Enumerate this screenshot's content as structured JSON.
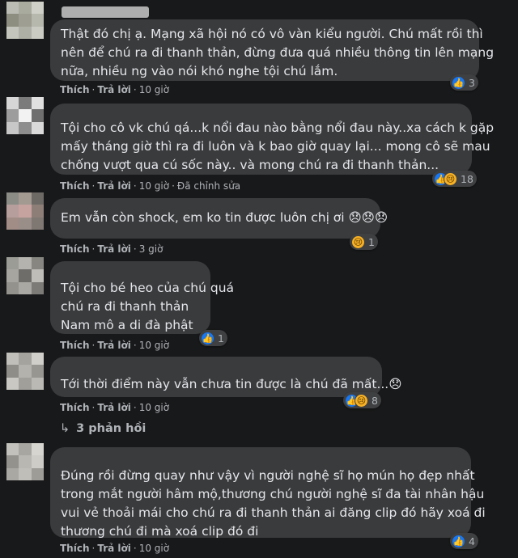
{
  "actions": {
    "like": "Thích",
    "reply": "Trả lời",
    "edited": "Đã chỉnh sửa"
  },
  "colors": {
    "like": "#1877f2",
    "sad": "#f7b125",
    "bubble": "#3a3b3c",
    "background": "#18191a"
  },
  "comments": [
    {
      "lines": [
        "Thật đó chị ạ. Mạng xã hội nó có vô vàn kiểu người. Chú mất rồi thì",
        "nên để chú ra đi thanh thản, đừng đưa quá nhiều thông tin lên mạng",
        "nữa, nhiều ng vào nói khó nghe tội chú lắm."
      ],
      "time": "10 giờ",
      "reactions": {
        "icons": [
          "like-icon"
        ],
        "count": "3"
      }
    },
    {
      "lines": [
        "Tội cho cô vk chú qá...k nổi đau nào bằng nổi đau này..xa cách k gặp",
        "mấy tháng giờ thì ra đi luôn và k bao giờ quay lại... mong cô sẽ mau",
        "chống vượt qua cú sốc này.. và mong chú ra đi thanh thản..."
      ],
      "time": "10 giờ",
      "reactions": {
        "icons": [
          "like-icon",
          "sad-icon"
        ],
        "count": "18"
      }
    },
    {
      "lines": [
        "Em vẫn còn shock, em ko tin được luôn chị ơi 😞😞😞"
      ],
      "time": "3 giờ",
      "reactions": {
        "icons": [
          "sad-icon"
        ],
        "count": "1"
      }
    },
    {
      "lines": [
        "Tội cho bé heo của chú quá",
        "chú ra đi thanh thản",
        "Nam mô a di đà phật"
      ],
      "time": "10 giờ",
      "reactions": {
        "icons": [
          "like-icon"
        ],
        "count": "1"
      }
    },
    {
      "lines": [
        "Tới thời điểm này vẫn chưa tin được là chú đã mất...😞"
      ],
      "time": "10 giờ",
      "reactions": {
        "icons": [
          "like-icon",
          "sad-icon"
        ],
        "count": "8"
      }
    },
    {
      "lines": [
        "Đúng rồi đừng quay như vậy vì người nghệ sĩ họ mún họ đẹp nhất",
        "trong mắt người hâm mộ,thương chú người nghệ sĩ đa tài nhân hậu",
        "vui vẻ thoải mái cho chú ra đi thanh thản ai đăng clip đó hãy xoá đi",
        "thương chú đi mà xoá clip đó đi"
      ],
      "time": "10 giờ",
      "reactions": {
        "icons": [
          "like-icon"
        ],
        "count": "4"
      }
    }
  ],
  "replies_link": {
    "arrow": "↳",
    "label": "3 phản hồi"
  }
}
